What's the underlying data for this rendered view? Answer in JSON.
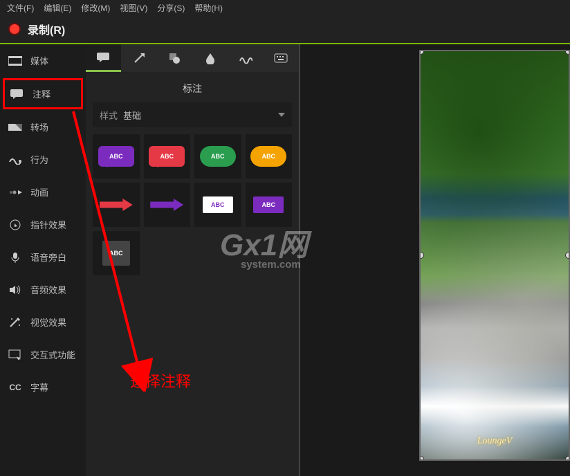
{
  "menu": {
    "file": "文件(F)",
    "edit": "编辑(E)",
    "modify": "修改(M)",
    "view": "视图(V)",
    "share": "分享(S)",
    "help": "帮助(H)"
  },
  "record": {
    "label": "录制(R)"
  },
  "sidebar": {
    "media": "媒体",
    "annotations": "注释",
    "transitions": "转场",
    "behaviors": "行为",
    "animations": "动画",
    "cursor": "指针效果",
    "voice": "语音旁白",
    "audio": "音频效果",
    "visual": "视觉效果",
    "interactive": "交互式功能",
    "captions": "字幕",
    "cc_abbr": "CC"
  },
  "panel": {
    "title": "标注",
    "style_label": "样式",
    "style_value": "基础",
    "shape_text": "ABC"
  },
  "callout": {
    "text": "选择注释"
  },
  "watermark": {
    "gx": "Gx1网",
    "gx_sub": "system.com",
    "lounge": "LoungeV"
  }
}
